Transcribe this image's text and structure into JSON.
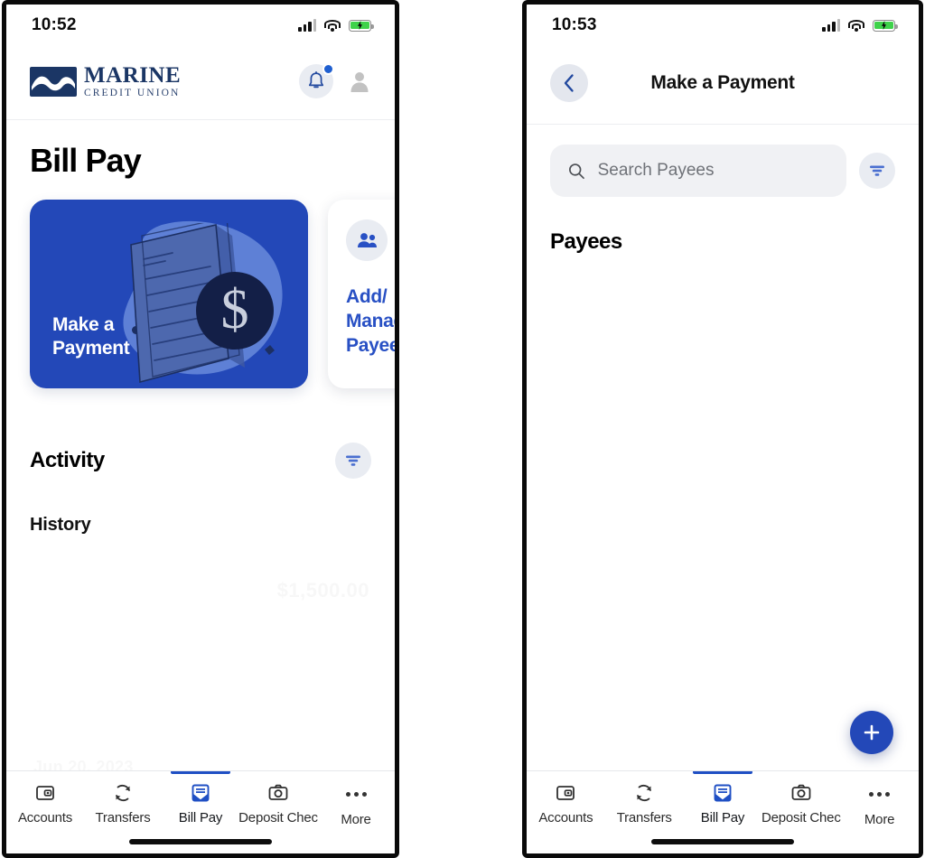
{
  "colors": {
    "brand_blue": "#2348b8",
    "link_blue": "#2850c4",
    "navy": "#1b3665",
    "nav_active": "#1f4fc4",
    "chip_gray": "#e9ecf2",
    "battery_green": "#3ed24a"
  },
  "left_phone": {
    "status": {
      "time": "10:52",
      "signal_icon": "signal-bars-icon",
      "wifi_icon": "wifi-icon",
      "battery_icon": "battery-charging-icon"
    },
    "header": {
      "logo_title": "MARINE",
      "logo_subtitle": "CREDIT UNION",
      "logo_mark": "wave-logo-icon",
      "bell_icon": "bell-icon",
      "bell_badge": "notification-dot",
      "avatar_icon": "person-avatar-icon"
    },
    "page_title": "Bill Pay",
    "cards": [
      {
        "label": "Make a\nPayment",
        "label_line1": "Make a",
        "label_line2": "Payment",
        "style": "primary",
        "art": "document-dollar-illustration"
      },
      {
        "label": "Add/\nManage\nPayees",
        "label_line1": "Add/",
        "label_line2": "Manage",
        "label_line3": "Payees",
        "style": "secondary",
        "icon": "people-icon"
      }
    ],
    "activity": {
      "title": "Activity",
      "filter_icon": "filter-icon",
      "history_label": "History",
      "ghost_amount": "$1,500.00",
      "ghost_date": "Jun 20, 2023"
    },
    "bottom_nav": {
      "items": [
        {
          "label": "Accounts",
          "icon": "wallet-icon",
          "active": false
        },
        {
          "label": "Transfers",
          "icon": "sync-arrows-icon",
          "active": false
        },
        {
          "label": "Bill Pay",
          "icon": "envelope-icon",
          "active": true
        },
        {
          "label": "Deposit Chec",
          "icon": "camera-icon",
          "active": false
        },
        {
          "label": "More",
          "icon": "ellipsis-icon",
          "active": false
        }
      ]
    }
  },
  "right_phone": {
    "status": {
      "time": "10:53",
      "signal_icon": "signal-bars-icon",
      "wifi_icon": "wifi-icon",
      "battery_icon": "battery-charging-icon"
    },
    "header": {
      "back_icon": "chevron-left-icon",
      "title": "Make a Payment"
    },
    "search": {
      "placeholder": "Search Payees",
      "value": "",
      "search_icon": "search-icon",
      "filter_icon": "filter-icon"
    },
    "payees_title": "Payees",
    "fab": {
      "icon": "plus-icon",
      "label": "Add payee"
    },
    "bottom_nav": {
      "items": [
        {
          "label": "Accounts",
          "icon": "wallet-icon",
          "active": false
        },
        {
          "label": "Transfers",
          "icon": "sync-arrows-icon",
          "active": false
        },
        {
          "label": "Bill Pay",
          "icon": "envelope-icon",
          "active": true
        },
        {
          "label": "Deposit Chec",
          "icon": "camera-icon",
          "active": false
        },
        {
          "label": "More",
          "icon": "ellipsis-icon",
          "active": false
        }
      ]
    }
  }
}
